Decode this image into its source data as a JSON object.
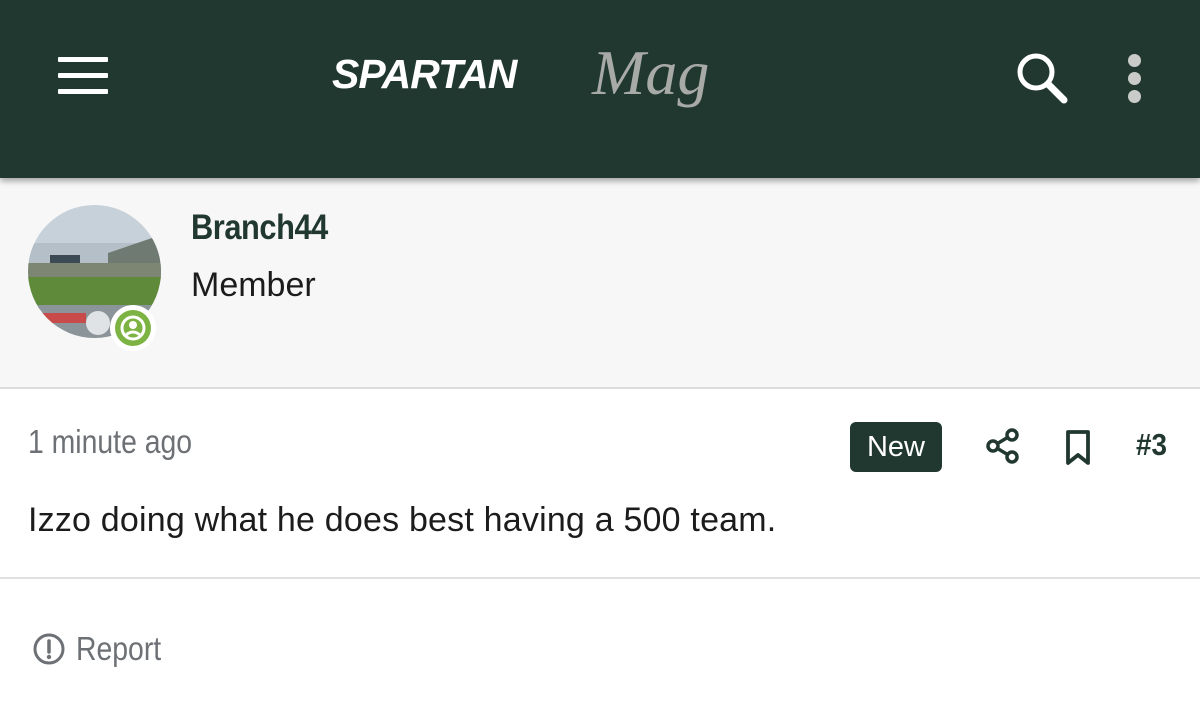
{
  "header": {
    "logo_primary": "SPARTAN",
    "logo_secondary": "Mag",
    "menu_icon": "hamburger-menu-icon",
    "search_icon": "search-icon",
    "more_icon": "vertical-ellipsis-icon",
    "background_color": "#213830"
  },
  "author": {
    "username": "Branch44",
    "role": "Member",
    "avatar_alt": "stadium photo",
    "status_icon": "user-circle-icon",
    "status_color": "#7cb342"
  },
  "post": {
    "timestamp": "1 minute ago",
    "badge": "New",
    "share_icon": "share-icon",
    "bookmark_icon": "bookmark-icon",
    "number": "#3",
    "body": "Izzo doing what he does best having a 500 team."
  },
  "footer": {
    "report_label": "Report",
    "report_icon": "exclamation-circle-icon"
  },
  "colors": {
    "brand_green": "#213830",
    "muted_text": "#6d7175",
    "author_background": "#f7f7f7"
  }
}
